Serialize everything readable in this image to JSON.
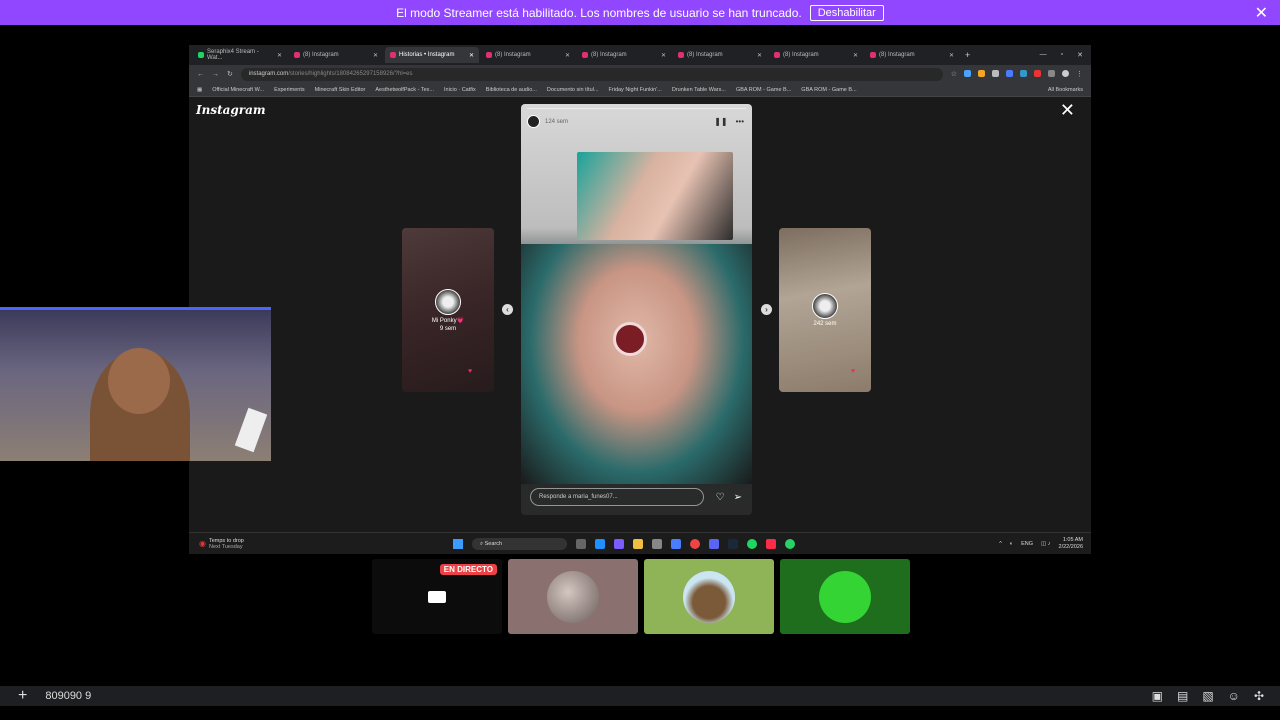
{
  "banner": {
    "text": "El modo Streamer está habilitado. Los nombres de usuario se han truncado.",
    "button": "Deshabilitar",
    "close": "✕"
  },
  "browser": {
    "tabs": [
      {
        "title": "Seraphix4 Stream - Wat...",
        "icon": "stream-icon",
        "active": false
      },
      {
        "title": "(8) Instagram",
        "icon": "instagram-icon",
        "active": false
      },
      {
        "title": "Historias • Instagram",
        "icon": "instagram-icon",
        "active": true
      },
      {
        "title": "(8) Instagram",
        "icon": "instagram-icon",
        "active": false
      },
      {
        "title": "(8) Instagram",
        "icon": "instagram-icon",
        "active": false
      },
      {
        "title": "(8) Instagram",
        "icon": "instagram-icon",
        "active": false
      },
      {
        "title": "(8) Instagram",
        "icon": "instagram-icon",
        "active": false
      },
      {
        "title": "(8) Instagram",
        "icon": "instagram-icon",
        "active": false
      }
    ],
    "url_host": "instagram.com",
    "url_path": "/stories/highlights/18084265297158926/?hl=es",
    "bookmarks": [
      "Official Minecraft W...",
      "Experiments",
      "Minecraft Skin Editor",
      "AesthetwolfPack - Tex...",
      "Inicio · Catfix",
      "Biblioteca de audio...",
      "Documento sin títul...",
      "Friday Night Funkin'...",
      "Drunken Table Wars...",
      "GBA ROM - Game B...",
      "GBA ROM - Game B..."
    ],
    "all_bookmarks": "All Bookmarks"
  },
  "instagram": {
    "logo": "Instagram",
    "left_story": {
      "name": "Mi Ponky💗",
      "time": "9 sem"
    },
    "right_story": {
      "time": "242 sem"
    },
    "main_story": {
      "time": "124 sem",
      "reply_placeholder": "Responde a maria_funes07..."
    }
  },
  "taskbar": {
    "weather_title": "Temps to drop",
    "weather_sub": "Next Tuesday",
    "search": "Search",
    "lang": "ENG",
    "time": "1:05 AM",
    "date": "2/22/2026"
  },
  "participants": {
    "live_badge": "EN DIRECTO"
  },
  "bottom_bar": {
    "text": "809090 9"
  },
  "colors": {
    "streamer_banner": "#9146ff",
    "live_badge": "#ed4245"
  }
}
